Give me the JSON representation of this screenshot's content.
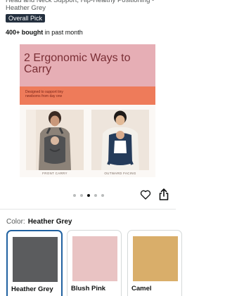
{
  "product": {
    "title_fragment": "Head and Neck Support, Hip-Healthy Positioning - Heather Grey",
    "badge": "Overall Pick",
    "bought_count": "400+ bought",
    "bought_suffix": " in past month"
  },
  "gallery": {
    "headline": "2 Ergonomic Ways to Carry",
    "tagline": "Designed to support tiny newborns from day one",
    "photos": [
      {
        "label": "FRONT CARRY"
      },
      {
        "label": "OUTWARD FACING"
      }
    ],
    "dots_total": 5,
    "dots_active_index": 2
  },
  "actions": {
    "favorite_icon": "heart-icon",
    "share_icon": "share-icon"
  },
  "color_selector": {
    "label": "Color:",
    "selected_value": "Heather Grey",
    "options": [
      {
        "name": "Heather Grey",
        "swatch": "#5b5c5e"
      },
      {
        "name": "Blush Pink",
        "swatch": "#e9c3c3"
      },
      {
        "name": "Camel",
        "swatch": "#d9ae6a"
      }
    ]
  },
  "colors": {
    "badge_bg": "#232f3e",
    "selected_border": "#2162a1",
    "hero_pink": "#e6aeb5",
    "hero_orange": "#ee7b5a"
  }
}
